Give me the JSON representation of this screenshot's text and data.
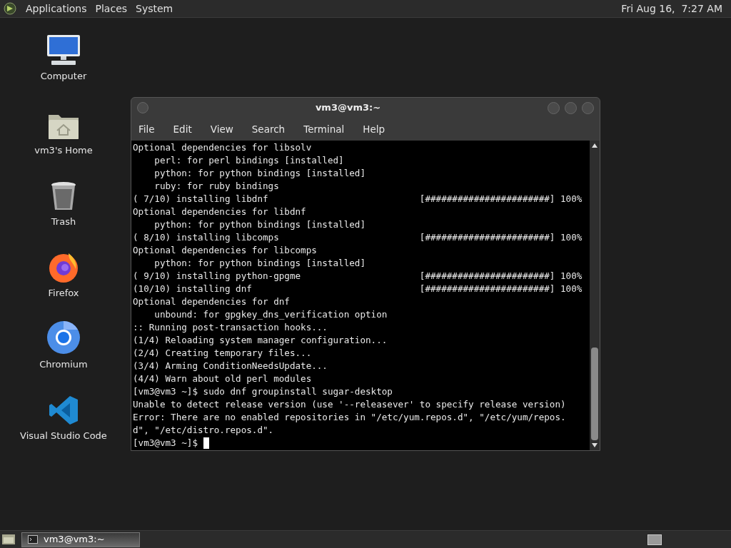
{
  "top_panel": {
    "menus": [
      "Applications",
      "Places",
      "System"
    ],
    "clock": "Fri Aug 16,  7:27 AM"
  },
  "desktop_icons": [
    {
      "kind": "computer",
      "label": "Computer"
    },
    {
      "kind": "home",
      "label": "vm3's Home"
    },
    {
      "kind": "trash",
      "label": "Trash"
    },
    {
      "kind": "firefox",
      "label": "Firefox"
    },
    {
      "kind": "chromium",
      "label": "Chromium"
    },
    {
      "kind": "vscode",
      "label": "Visual Studio Code"
    }
  ],
  "terminal": {
    "title": "vm3@vm3:~",
    "menu": [
      "File",
      "Edit",
      "View",
      "Search",
      "Terminal",
      "Help"
    ],
    "lines": [
      "Optional dependencies for libsolv",
      "    perl: for perl bindings [installed]",
      "    python: for python bindings [installed]",
      "    ruby: for ruby bindings",
      "( 7/10) installing libdnf                            [#######################] 100%",
      "Optional dependencies for libdnf",
      "    python: for python bindings [installed]",
      "( 8/10) installing libcomps                          [#######################] 100%",
      "Optional dependencies for libcomps",
      "    python: for python bindings [installed]",
      "( 9/10) installing python-gpgme                      [#######################] 100%",
      "(10/10) installing dnf                               [#######################] 100%",
      "Optional dependencies for dnf",
      "    unbound: for gpgkey_dns_verification option",
      ":: Running post-transaction hooks...",
      "(1/4) Reloading system manager configuration...",
      "(2/4) Creating temporary files...",
      "(3/4) Arming ConditionNeedsUpdate...",
      "(4/4) Warn about old perl modules",
      "[vm3@vm3 ~]$ sudo dnf groupinstall sugar-desktop",
      "Unable to detect release version (use '--releasever' to specify release version)",
      "Error: There are no enabled repositories in \"/etc/yum.repos.d\", \"/etc/yum/repos.",
      "d\", \"/etc/distro.repos.d\"."
    ],
    "prompt": "[vm3@vm3 ~]$ "
  },
  "taskbar": {
    "tasks": [
      {
        "label": "vm3@vm3:~",
        "selected": true
      }
    ]
  }
}
